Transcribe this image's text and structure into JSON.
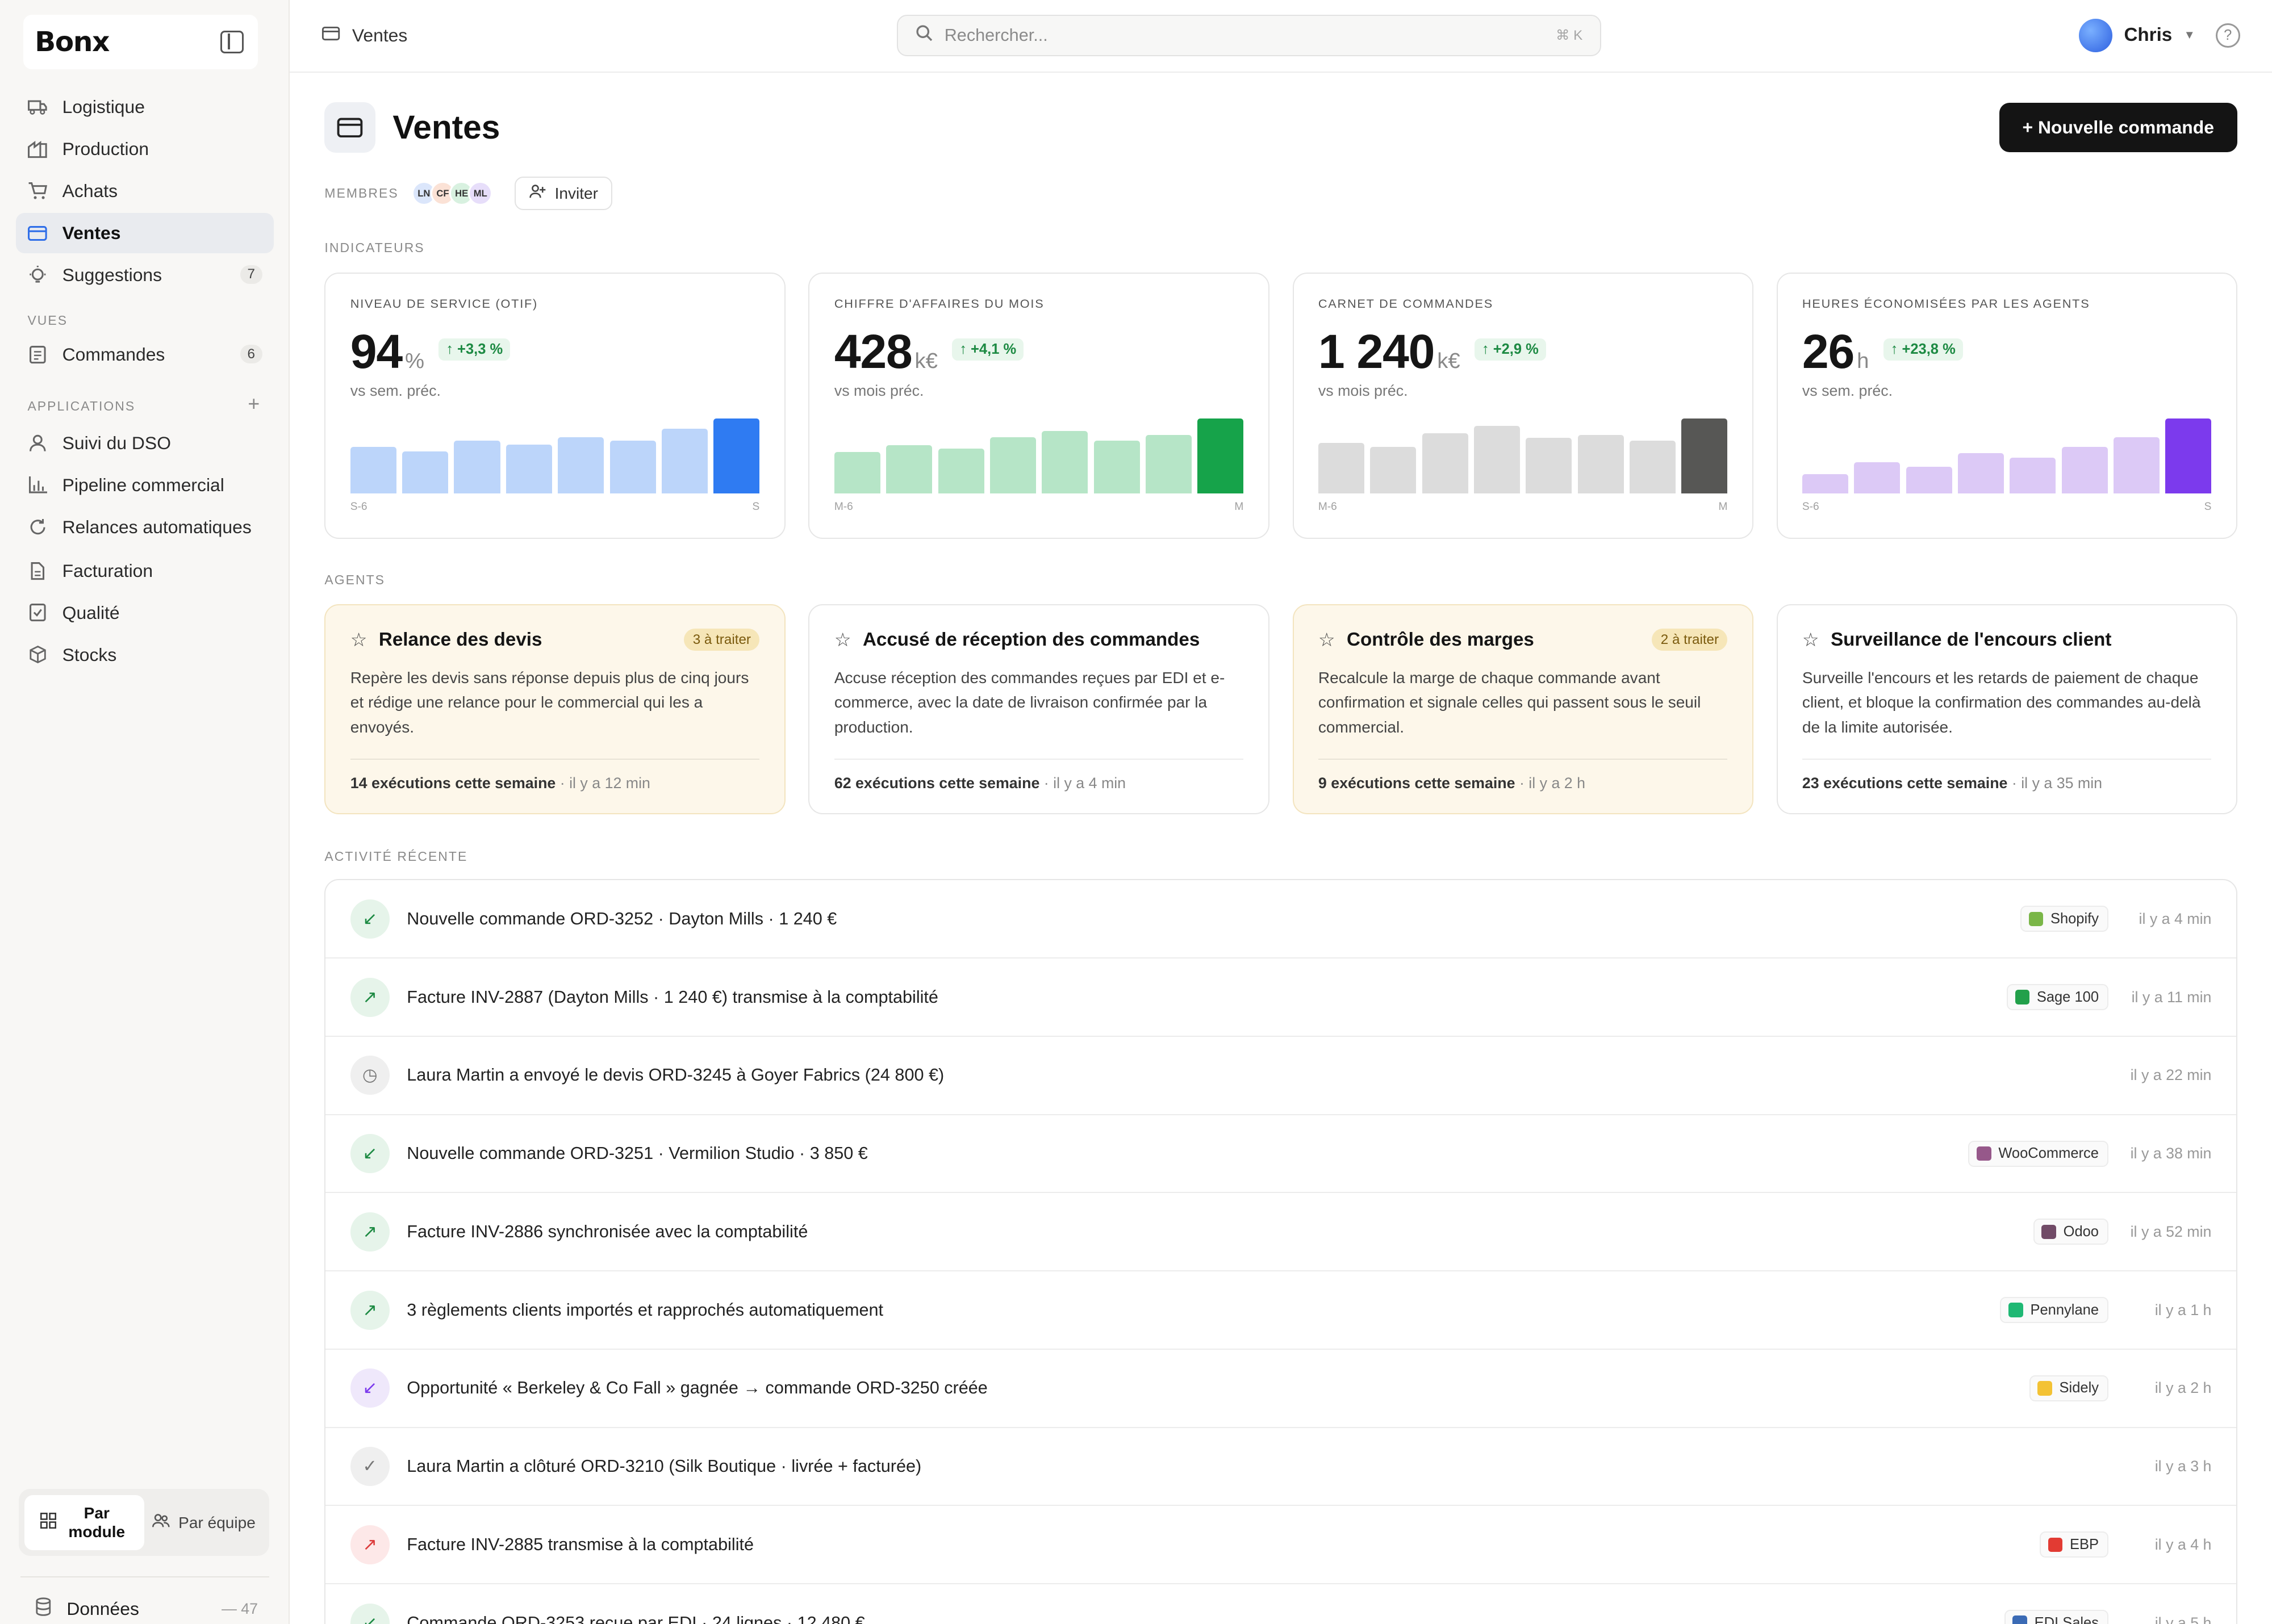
{
  "app": {
    "logo": "Bonx"
  },
  "sidebar": {
    "nav": [
      {
        "label": "Logistique",
        "icon": "truck-icon"
      },
      {
        "label": "Production",
        "icon": "factory-icon"
      },
      {
        "label": "Achats",
        "icon": "cart-icon"
      },
      {
        "label": "Ventes",
        "icon": "card-icon",
        "active": true
      },
      {
        "label": "Suggestions",
        "icon": "bulb-icon",
        "count": "7"
      }
    ],
    "views_label": "VUES",
    "views": [
      {
        "label": "Commandes",
        "icon": "list-icon",
        "count": "6"
      }
    ],
    "apps_label": "APPLICATIONS",
    "apps": [
      {
        "label": "Suivi du DSO",
        "icon": "user-icon"
      },
      {
        "label": "Pipeline commercial",
        "icon": "chart-icon"
      },
      {
        "label": "Relances automatiques",
        "icon": "refresh-icon"
      }
    ],
    "tools": [
      {
        "label": "Facturation",
        "icon": "doc-icon"
      },
      {
        "label": "Qualité",
        "icon": "check-doc-icon"
      },
      {
        "label": "Stocks",
        "icon": "box-icon"
      }
    ],
    "toggle": {
      "by_module": "Par module",
      "by_team": "Par équipe"
    },
    "data": {
      "label": "Données",
      "count": "47"
    }
  },
  "topbar": {
    "breadcrumb": "Ventes",
    "search_placeholder": "Rechercher...",
    "search_shortcut": "⌘ K",
    "user": "Chris",
    "help": "?"
  },
  "page": {
    "title": "Ventes",
    "new_button": "+ Nouvelle commande",
    "members_label": "MEMBRES",
    "members": [
      {
        "initials": "LN",
        "color": "#dbe6fb"
      },
      {
        "initials": "CF",
        "color": "#fbe2d6"
      },
      {
        "initials": "HE",
        "color": "#d8f1e0"
      },
      {
        "initials": "ML",
        "color": "#e7defa"
      }
    ],
    "invite": "Inviter",
    "indicators_label": "INDICATEURS",
    "agents_label": "AGENTS",
    "activity_label": "ACTIVITÉ RÉCENTE"
  },
  "kpis": [
    {
      "title": "NIVEAU DE SERVICE (OTIF)",
      "value": "94",
      "unit": "%",
      "delta": "↑ +3,3 %",
      "sub": "vs sem. préc.",
      "axis_start": "S-6",
      "axis_end": "S",
      "bar_color": "#bcd5fa",
      "bar_last": "#2f7bf2",
      "bars": [
        0.62,
        0.56,
        0.7,
        0.65,
        0.75,
        0.7,
        0.86,
        1.0
      ]
    },
    {
      "title": "CHIFFRE D'AFFAIRES DU MOIS",
      "value": "428",
      "unit": "k€",
      "delta": "↑ +4,1 %",
      "sub": "vs mois préc.",
      "axis_start": "M-6",
      "axis_end": "M",
      "bar_color": "#b6e5c7",
      "bar_last": "#16a34a",
      "bars": [
        0.55,
        0.64,
        0.6,
        0.75,
        0.83,
        0.7,
        0.78,
        1.0
      ]
    },
    {
      "title": "CARNET DE COMMANDES",
      "value": "1 240",
      "unit": "k€",
      "delta": "↑ +2,9 %",
      "sub": "vs mois préc.",
      "axis_start": "M-6",
      "axis_end": "M",
      "bar_color": "#dcdcdc",
      "bar_last": "#575755",
      "bars": [
        0.67,
        0.62,
        0.8,
        0.9,
        0.74,
        0.78,
        0.7,
        1.0
      ]
    },
    {
      "title": "HEURES ÉCONOMISÉES PAR LES AGENTS",
      "value": "26",
      "unit": "h",
      "delta": "↑ +23,8 %",
      "sub": "vs sem. préc.",
      "axis_start": "S-6",
      "axis_end": "S",
      "bar_color": "#dcc9f6",
      "bar_last": "#7c3aed",
      "bars": [
        0.26,
        0.42,
        0.36,
        0.54,
        0.48,
        0.62,
        0.75,
        1.0
      ]
    }
  ],
  "agents": [
    {
      "title": "Relance des devis",
      "badge": "3 à traiter",
      "warm": true,
      "desc": "Repère les devis sans réponse depuis plus de cinq jours et rédige une relance pour le commercial qui les a envoyés.",
      "runs": "14 exécutions cette semaine",
      "when": "· il y a 12 min"
    },
    {
      "title": "Accusé de réception des commandes",
      "badge": "",
      "warm": false,
      "desc": "Accuse réception des commandes reçues par EDI et e-commerce, avec la date de livraison confirmée par la production.",
      "runs": "62 exécutions cette semaine",
      "when": "· il y a 4 min"
    },
    {
      "title": "Contrôle des marges",
      "badge": "2 à traiter",
      "warm": true,
      "desc": "Recalcule la marge de chaque commande avant confirmation et signale celles qui passent sous le seuil commercial.",
      "runs": "9 exécutions cette semaine",
      "when": "· il y a 2 h"
    },
    {
      "title": "Surveillance de l'encours client",
      "badge": "",
      "warm": false,
      "desc": "Surveille l'encours et les retards de paiement de chaque client, et bloque la confirmation des commandes au-delà de la limite autorisée.",
      "runs": "23 exécutions cette semaine",
      "when": "· il y a 35 min"
    }
  ],
  "activity": [
    {
      "text": "Nouvelle commande ORD-3252 · Dayton Mills · 1 240 €",
      "icon": "arrow-in-icon",
      "glyph": "↙",
      "bg": "#e6f4ea",
      "fg": "#1d8a43",
      "source": "Shopify",
      "source_color": "#7ab648",
      "time": "il y a 4 min"
    },
    {
      "text": "Facture INV-2887 (Dayton Mills · 1 240 €) transmise à la comptabilité",
      "icon": "arrow-out-icon",
      "glyph": "↗",
      "bg": "#e6f4ea",
      "fg": "#1d8a43",
      "source": "Sage 100",
      "source_color": "#22a04a",
      "time": "il y a 11 min"
    },
    {
      "text": "Laura Martin a envoyé le devis ORD-3245 à Goyer Fabrics (24 800 €)",
      "icon": "clock-icon",
      "glyph": "◷",
      "bg": "#efefef",
      "fg": "#777",
      "source": "",
      "source_color": "",
      "time": "il y a 22 min"
    },
    {
      "text": "Nouvelle commande ORD-3251 · Vermilion Studio · 3 850 €",
      "icon": "arrow-in-icon",
      "glyph": "↙",
      "bg": "#e6f4ea",
      "fg": "#1d8a43",
      "source": "WooCommerce",
      "source_color": "#96588a",
      "time": "il y a 38 min"
    },
    {
      "text": "Facture INV-2886 synchronisée avec la comptabilité",
      "icon": "arrow-out-icon",
      "glyph": "↗",
      "bg": "#e6f4ea",
      "fg": "#1d8a43",
      "source": "Odoo",
      "source_color": "#714b67",
      "time": "il y a 52 min"
    },
    {
      "text": "3 règlements clients importés et rapprochés automatiquement",
      "icon": "arrow-out-icon",
      "glyph": "↗",
      "bg": "#e6f4ea",
      "fg": "#1d8a43",
      "source": "Pennylane",
      "source_color": "#1fb874",
      "time": "il y a 1 h"
    },
    {
      "text": "Opportunité « Berkeley & Co Fall » gagnée → commande ORD-3250 créée",
      "icon": "arrow-in-icon",
      "glyph": "↙",
      "bg": "#efe8fb",
      "fg": "#7c3aed",
      "source": "Sidely",
      "source_color": "#f3c234",
      "time": "il y a 2 h"
    },
    {
      "text": "Laura Martin a clôturé ORD-3210 (Silk Boutique · livrée + facturée)",
      "icon": "check-circle-icon",
      "glyph": "✓",
      "bg": "#efefef",
      "fg": "#777",
      "source": "",
      "source_color": "",
      "time": "il y a 3 h"
    },
    {
      "text": "Facture INV-2885 transmise à la comptabilité",
      "icon": "arrow-out-icon",
      "glyph": "↗",
      "bg": "#fde8e8",
      "fg": "#dc3b3b",
      "source": "EBP",
      "source_color": "#e23b33",
      "time": "il y a 4 h"
    },
    {
      "text": "Commande ORD-3253 reçue par EDI · 24 lignes · 12 480 €",
      "icon": "arrow-in-icon",
      "glyph": "↙",
      "bg": "#e6f4ea",
      "fg": "#1d8a43",
      "source": "EDI Sales",
      "source_color": "#3b6bb5",
      "time": "il y a 5 h"
    }
  ]
}
